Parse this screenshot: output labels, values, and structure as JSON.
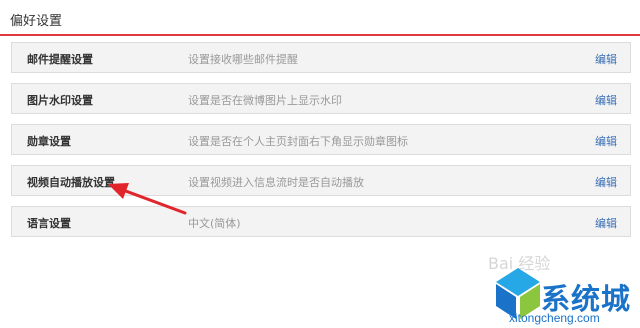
{
  "header": {
    "title": "偏好设置"
  },
  "settings": [
    {
      "name": "邮件提醒设置",
      "desc": "设置接收哪些邮件提醒",
      "action": "编辑"
    },
    {
      "name": "图片水印设置",
      "desc": "设置是否在微博图片上显示水印",
      "action": "编辑"
    },
    {
      "name": "勋章设置",
      "desc": "设置是否在个人主页封面右下角显示勋章图标",
      "action": "编辑"
    },
    {
      "name": "视频自动播放设置",
      "desc": "设置视频进入信息流时是否自动播放",
      "action": "编辑"
    },
    {
      "name": "语言设置",
      "desc": "中文(简体)",
      "action": "编辑"
    }
  ],
  "annotation": {
    "color": "#e0252b"
  },
  "watermark": {
    "brand": "系统城",
    "url": "xitongcheng.com",
    "faint": "Bai 经验",
    "color": "#1a73c9"
  },
  "colors": {
    "accent_line": "#e0393e",
    "link": "#3b6fb6",
    "row_bg": "#f3f3f3"
  }
}
